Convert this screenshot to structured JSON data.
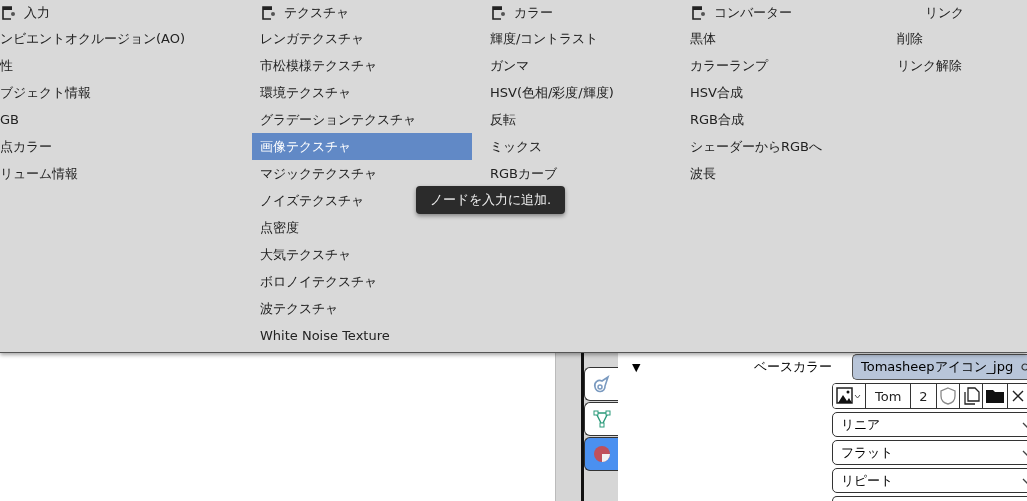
{
  "menu": {
    "columns": [
      {
        "kind": "nodes",
        "title": "入力",
        "items": [
          {
            "label": "ンビエントオクルージョン(AO)",
            "selected": false
          },
          {
            "label": "性",
            "selected": false
          },
          {
            "label": "ブジェクト情報",
            "selected": false
          },
          {
            "label": "GB",
            "selected": false
          },
          {
            "label": "点カラー",
            "selected": false
          },
          {
            "label": "リューム情報",
            "selected": false
          }
        ]
      },
      {
        "kind": "nodes",
        "title": "テクスチャ",
        "items": [
          {
            "label": "レンガテクスチャ",
            "selected": false
          },
          {
            "label": "市松模様テクスチャ",
            "selected": false
          },
          {
            "label": "環境テクスチャ",
            "selected": false
          },
          {
            "label": "グラデーションテクスチャ",
            "selected": false
          },
          {
            "label": "画像テクスチャ",
            "selected": true
          },
          {
            "label": "マジックテクスチャ",
            "selected": false
          },
          {
            "label": "ノイズテクスチャ",
            "selected": false
          },
          {
            "label": "点密度",
            "selected": false
          },
          {
            "label": "大気テクスチャ",
            "selected": false
          },
          {
            "label": "ボロノイテクスチャ",
            "selected": false
          },
          {
            "label": "波テクスチャ",
            "selected": false
          },
          {
            "label": "White Noise Texture",
            "selected": false
          }
        ]
      },
      {
        "kind": "nodes",
        "title": "カラー",
        "items": [
          {
            "label": "輝度/コントラスト",
            "selected": false
          },
          {
            "label": "ガンマ",
            "selected": false
          },
          {
            "label": "HSV(色相/彩度/輝度)",
            "selected": false
          },
          {
            "label": "反転",
            "selected": false
          },
          {
            "label": "ミックス",
            "selected": false
          },
          {
            "label": "RGBカーブ",
            "selected": false
          }
        ]
      },
      {
        "kind": "nodes",
        "title": "コンバーター",
        "items": [
          {
            "label": "黒体",
            "selected": false
          },
          {
            "label": "カラーランプ",
            "selected": false
          },
          {
            "label": "HSV合成",
            "selected": false
          },
          {
            "label": "RGB合成",
            "selected": false
          },
          {
            "label": "シェーダーからRGBへ",
            "selected": false
          },
          {
            "label": "波長",
            "selected": false
          }
        ]
      },
      {
        "kind": "links",
        "title": "リンク",
        "items": [
          {
            "label": "削除",
            "selected": false
          },
          {
            "label": "リンク解除",
            "selected": false
          }
        ]
      }
    ]
  },
  "tooltip": {
    "text": "ノードを入力に追加."
  },
  "properties": {
    "tabs": [
      {
        "kind": "object-data",
        "selected": false
      },
      {
        "kind": "mesh",
        "selected": false
      },
      {
        "kind": "material",
        "selected": true
      }
    ],
    "socket": {
      "toggle": "▼",
      "label": "ベースカラー",
      "value": "Tomasheepアイコン_jpg"
    },
    "image_toolbar": {
      "name": "Tom",
      "users": "2"
    },
    "dropdowns": [
      {
        "value": "リニア"
      },
      {
        "value": "フラット"
      },
      {
        "value": "リピート"
      }
    ]
  }
}
